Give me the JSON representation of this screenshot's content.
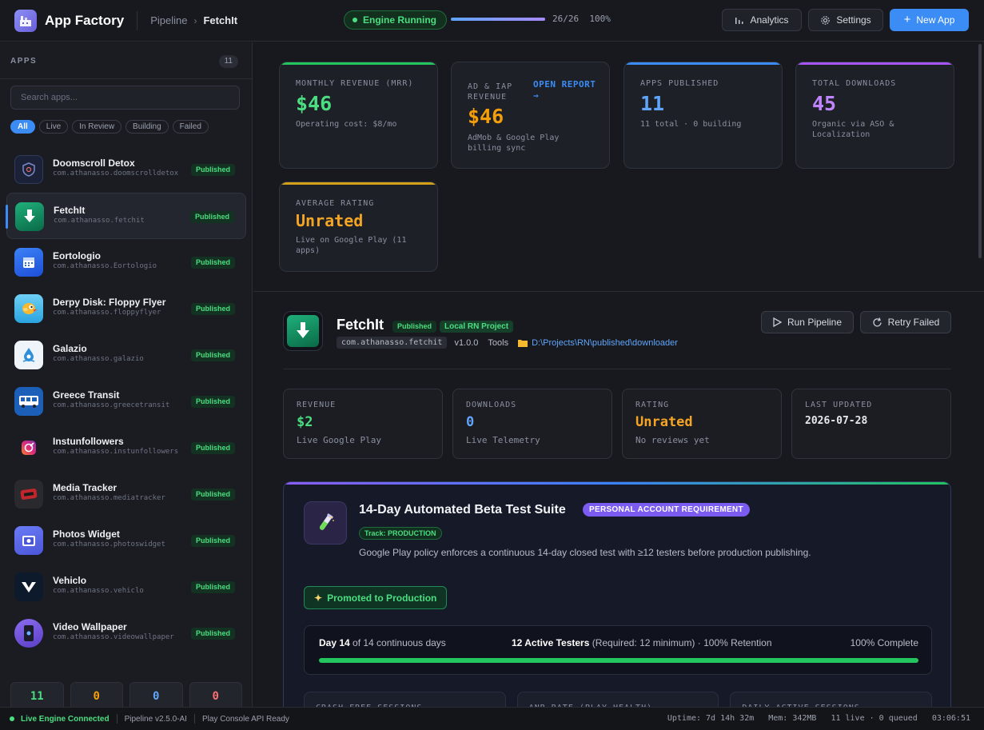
{
  "header": {
    "brand": "App Factory",
    "breadcrumb": [
      "Pipeline",
      "FetchIt"
    ],
    "crumb_sep": "›",
    "engine_status": "Engine Running",
    "progress_text": "26/26",
    "progress_pct_text": "100%",
    "progress_fraction": 1.0,
    "analytics_label": "Analytics",
    "settings_label": "Settings",
    "new_app_label": "New App"
  },
  "sidebar": {
    "heading": "APPS",
    "count": "11",
    "search_placeholder": "Search apps...",
    "filters": [
      "All",
      "Live",
      "In Review",
      "Building",
      "Failed"
    ],
    "apps": [
      {
        "name": "Doomscroll Detox",
        "pkg": "com.athanasso.doomscrolldetox",
        "status": "Published",
        "icon": "shield-icon",
        "color": "#1b2238"
      },
      {
        "name": "FetchIt",
        "pkg": "com.athanasso.fetchit",
        "status": "Published",
        "icon": "download-arrow-icon",
        "color": "#0f8a5c"
      },
      {
        "name": "Eortologio",
        "pkg": "com.athanasso.Eortologio",
        "status": "Published",
        "icon": "calendar-icon",
        "color": "#2f6fd8"
      },
      {
        "name": "Derpy Disk: Floppy Flyer",
        "pkg": "com.athanasso.floppyflyer",
        "status": "Published",
        "icon": "bird-icon",
        "color": "#3fb6e8"
      },
      {
        "name": "Galazio",
        "pkg": "com.athanasso.galazio",
        "status": "Published",
        "icon": "water-drop-icon",
        "color": "#e9f1f8"
      },
      {
        "name": "Greece Transit",
        "pkg": "com.athanasso.greecetransit",
        "status": "Published",
        "icon": "bus-icon",
        "color": "#1b5fb8"
      },
      {
        "name": "Instunfollowers",
        "pkg": "com.athanasso.instunfollowers",
        "status": "Published",
        "icon": "target-icon",
        "color": "#c13584"
      },
      {
        "name": "Media Tracker",
        "pkg": "com.athanasso.mediatracker",
        "status": "Published",
        "icon": "media-icon",
        "color": "#b22222"
      },
      {
        "name": "Photos Widget",
        "pkg": "com.athanasso.photoswidget",
        "status": "Published",
        "icon": "photo-icon",
        "color": "#5b6cf0"
      },
      {
        "name": "Vehiclo",
        "pkg": "com.athanasso.vehiclo",
        "status": "Published",
        "icon": "v-logo-icon",
        "color": "#0d1a2b"
      },
      {
        "name": "Video Wallpaper",
        "pkg": "com.athanasso.videowallpaper",
        "status": "Published",
        "icon": "phone-icon",
        "color": "#6d4fd1"
      }
    ],
    "stats": [
      {
        "value": "11",
        "color": "#4ade80"
      },
      {
        "value": "0",
        "color": "#f59e0b"
      },
      {
        "value": "0",
        "color": "#60a5fa"
      },
      {
        "value": "0",
        "color": "#f87171"
      }
    ]
  },
  "kpis": [
    {
      "label": "MONTHLY REVENUE (MRR)",
      "value": "$46",
      "sub": "Operating cost: $8/mo",
      "color": "#4ade80"
    },
    {
      "label": "AD & IAP REVENUE",
      "link": "OPEN REPORT →",
      "value": "$46",
      "sub": "AdMob & Google Play billing sync",
      "color": "#f59e0b"
    },
    {
      "label": "APPS PUBLISHED",
      "value": "11",
      "sub": "11 total · 0 building",
      "color": "#60a5fa"
    },
    {
      "label": "TOTAL DOWNLOADS",
      "value": "45",
      "sub": "Organic via ASO & Localization",
      "color": "#c084fc"
    },
    {
      "label": "AVERAGE RATING",
      "value": "Unrated",
      "sub": "Live on Google Play (11 apps)",
      "color": "#f5a524"
    }
  ],
  "detail": {
    "name": "FetchIt",
    "status_tag": "Published",
    "project_tag": "Local RN Project",
    "pkg": "com.athanasso.fetchit",
    "version": "v1.0.0",
    "category": "Tools",
    "path": "D:\\Projects\\RN\\published\\downloader",
    "run_label": "Run Pipeline",
    "retry_label": "Retry Failed",
    "stats": [
      {
        "label": "REVENUE",
        "value": "$2",
        "sub": "Live Google Play",
        "color": "#4ade80"
      },
      {
        "label": "DOWNLOADS",
        "value": "0",
        "sub": "Live Telemetry",
        "color": "#60a5fa"
      },
      {
        "label": "RATING",
        "value": "Unrated",
        "sub": "No reviews yet",
        "color": "#f5a524"
      },
      {
        "label": "LAST UPDATED",
        "value": "2026-07-28",
        "sub": "",
        "color": "#e6e8ee"
      }
    ]
  },
  "beta": {
    "title": "14-Day Automated Beta Test Suite",
    "requirement": "PERSONAL ACCOUNT REQUIREMENT",
    "track": "Track: PRODUCTION",
    "description": "Google Play policy enforces a continuous 14-day closed test with ≥12 testers before production publishing.",
    "promoted": "Promoted to Production",
    "day_strong": "Day 14",
    "day_rest": " of 14 continuous days",
    "testers_strong": "12 Active Testers",
    "testers_rest": " (Required: 12 minimum) · 100% Retention",
    "complete": "100% Complete",
    "progress_fraction": 1.0,
    "metrics": [
      "CRASH-FREE SESSIONS",
      "ANR RATE (PLAY HEALTH)",
      "DAILY ACTIVE SESSIONS"
    ]
  },
  "statusbar": {
    "connected": "Live Engine Connected",
    "version": "Pipeline v2.5.0-AI",
    "api": "Play Console API Ready",
    "uptime": "Uptime: 7d 14h 32m",
    "mem": "Mem: 342MB",
    "queue": "11 live · 0 queued",
    "time": "03:06:51"
  }
}
